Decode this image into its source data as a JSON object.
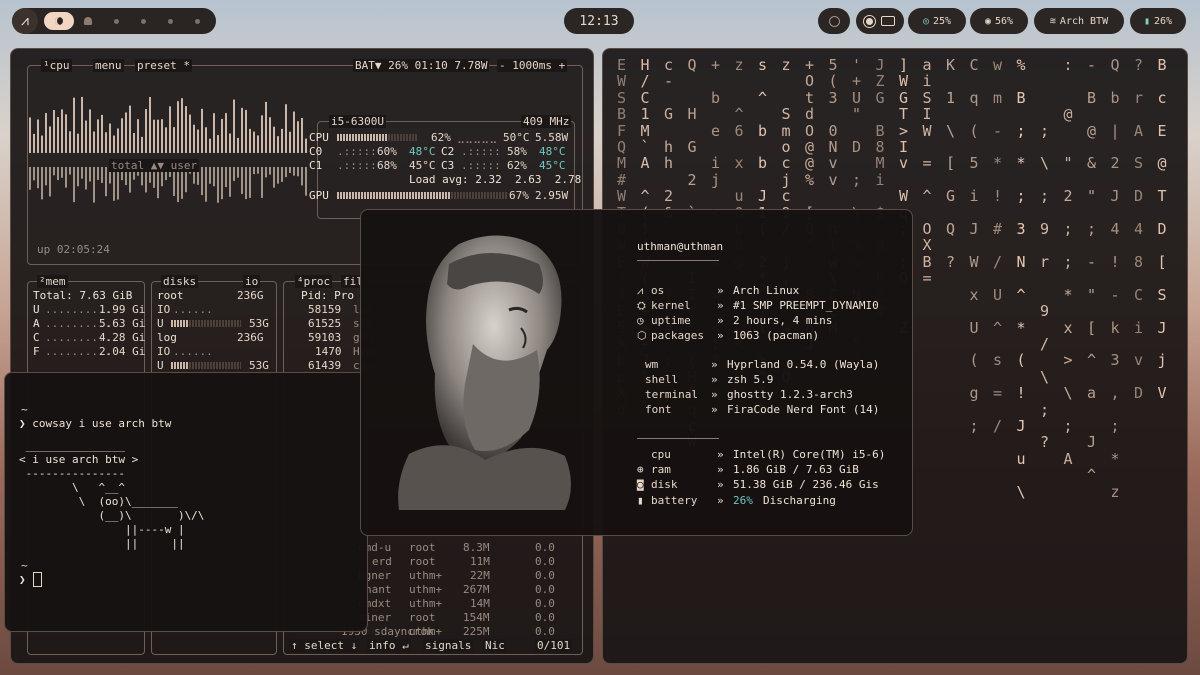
{
  "topbar": {
    "arch_glyph": "⩘",
    "clock": "12:13",
    "keyboard_icon": "keyboard-icon",
    "brightness": "25%",
    "volume": "56%",
    "wifi": "Arch BTW",
    "battery": "26%"
  },
  "btop": {
    "cpu_tab": "¹cpu",
    "menu": "menu",
    "preset": "preset *",
    "battery_status": "BAT▼ 26% 01:10 7.78W",
    "interval": "- 1000ms +",
    "total_user": "total ▲▼ user",
    "uptime": "up 02:05:24",
    "cpu_model": "i5-6300U",
    "freq": "409 MHz",
    "cpu_rows": [
      {
        "label": "CPU",
        "pct": "62%",
        "temp": "50°C",
        "watt": "5.58W",
        "fill": 0.62
      },
      {
        "label": "C0",
        "pct": "60%",
        "temp": "48°C",
        "label2": "C2",
        "pct2": "58%",
        "temp2": "48°C"
      },
      {
        "label": "C1",
        "pct": "68%",
        "temp": "45°C",
        "label2": "C3",
        "pct2": "62%",
        "temp2": "45°C"
      }
    ],
    "load_avg": "Load avg: 2.32  2.63  2.78",
    "gpu": {
      "label": "GPU",
      "pct": "67%",
      "watt": "2.95W",
      "fill": 0.67
    },
    "mem_tab": "²mem",
    "mem_total": "Total: 7.63 GiB",
    "mem_rows": [
      {
        "k": "U",
        "v": "1.99 Gi"
      },
      {
        "k": "A",
        "v": "5.63 Gi"
      },
      {
        "k": "C",
        "v": "4.28 Gi"
      },
      {
        "k": "F",
        "v": "2.04 Gi"
      }
    ],
    "disks_tab": "disks",
    "io_tab": "io",
    "disks": [
      {
        "name": "root",
        "size": "236G",
        "io": "IO",
        "used": "U",
        "usedsize": "53G"
      },
      {
        "name": "log",
        "size": "236G",
        "io": "IO",
        "used": "U",
        "usedsize": "53G"
      }
    ],
    "proc_tab": "⁴proc",
    "proc_filter": "fil",
    "proc_header": "Pid: Pro",
    "procs_top": [
      {
        "pid": "58159",
        "name": "loc"
      },
      {
        "pid": "61525",
        "name": "slu"
      },
      {
        "pid": "59103",
        "name": "gho"
      },
      {
        "pid": "1470",
        "name": "Hyp"
      },
      {
        "pid": "61439",
        "name": "cma"
      }
    ],
    "procs_bottom": [
      {
        "name": "emd-u",
        "user": "root",
        "mem": "8.3M",
        "cpu": "0.0"
      },
      {
        "name": "erd",
        "user": "root",
        "mem": "11M",
        "cpu": "0.0"
      },
      {
        "name": "bgner",
        "user": "uthm+",
        "mem": "22M",
        "cpu": "0.0"
      },
      {
        "name": "hant",
        "user": "uthm+",
        "mem": "267M",
        "cpu": "0.0"
      },
      {
        "name": "emdxt",
        "user": "uthm+",
        "mem": "14M",
        "cpu": "0.0"
      },
      {
        "name": "ainer",
        "user": "root",
        "mem": "154M",
        "cpu": "0.0"
      },
      {
        "name": "1930 sdayncrok",
        "user": "uthm+",
        "mem": "225M",
        "cpu": "0.0"
      }
    ],
    "footer_select": "↑ select ↓",
    "footer_info": "info ↵",
    "footer_signals": "signals",
    "footer_nic": "Nic",
    "footer_count": "0/101"
  },
  "terminal": {
    "tilde1": "~",
    "prompt1": "❯ cowsay i use arch btw",
    "cow": [
      " _______________",
      "< i use arch btw >",
      " ---------------",
      "        \\   ^__^",
      "         \\  (oo)\\_______",
      "            (__)\\       )\\/\\",
      "                ||----w |",
      "                ||     ||"
    ],
    "tilde2": "~",
    "prompt2": "❯"
  },
  "fastfetch": {
    "user_host": "uthman@uthman",
    "rows1": [
      {
        "icon": "⩘",
        "key": "os",
        "val": "Arch Linux"
      },
      {
        "icon": "⛭",
        "key": "kernel",
        "val": "#1 SMP PREEMPT_DYNAMI0"
      },
      {
        "icon": "◷",
        "key": "uptime",
        "val": "2 hours, 4 mins"
      },
      {
        "icon": "⬡",
        "key": "packages",
        "val": "1063 (pacman)"
      }
    ],
    "rows2": [
      {
        "key": "wm",
        "val": "Hyprland 0.54.0 (Wayla)"
      },
      {
        "key": "shell",
        "val": "zsh 5.9"
      },
      {
        "key": "terminal",
        "val": "ghostty 1.2.3-arch3"
      },
      {
        "key": "font",
        "val": "FiraCode Nerd Font (14)"
      }
    ],
    "rows3": [
      {
        "icon": "",
        "key": "cpu",
        "val": "Intel(R) Core(TM) i5-6)"
      },
      {
        "icon": "⊕",
        "key": "ram",
        "val": "1.86 GiB / 7.63 GiB"
      },
      {
        "icon": "◙",
        "key": "disk",
        "val": "51.38 GiB / 236.46 Gis"
      }
    ],
    "battery_key": "battery",
    "battery_pct": "26%",
    "battery_status": "Discharging"
  },
  "matrix_columns": [
    "EWSBFQM#WT0WE!1E5XbpXd",
    "H/C1M`A ^(!(W(*+++Jl",
    "c- G hh 2& \\  ]J# ;_",
    "Q  H G 2 ` t IIc; (HFqcW",
    "+ b e ij < i= = <;* a",
    "z  ^6 x u0u0@ # L< MW",
    "s ^ b b J1( 2* ]l >\"S5",
    "z  Smocjc9/ j,  w _Q",
    "+OtdO@@% [Q\"  8 bJ",
    "5(3 0Nvv  h(w\\CCM",
    "'+U\" D ; \\ %% Nf \"J",
    "JZG B8Mi $ a,hZ#",
    "]WGT>Iv Wq; ;O  Z",
    "aiSIW = ^ OXB=",
    "K 1 \\ [ G Q ?",
    "C q ( 5 i J W x U ( g ;",
    "w m - * ! # / U ^ s = /",
    "% B ; * ; 3 N ^ * ( ! J u \\",
    "    ; \\ ; 9 r  9 / \\ ; ?",
    ":  @  \" 2 ; ; * x > \\ ; A",
    "- B @ & \" ; - \" [ ^ a  J ^",
    "Q b | 2 J 4 ! - k 3 , ; * z",
    "? r A S D 4 8 C i v D",
    "B c E @ T D [ S J j V"
  ]
}
